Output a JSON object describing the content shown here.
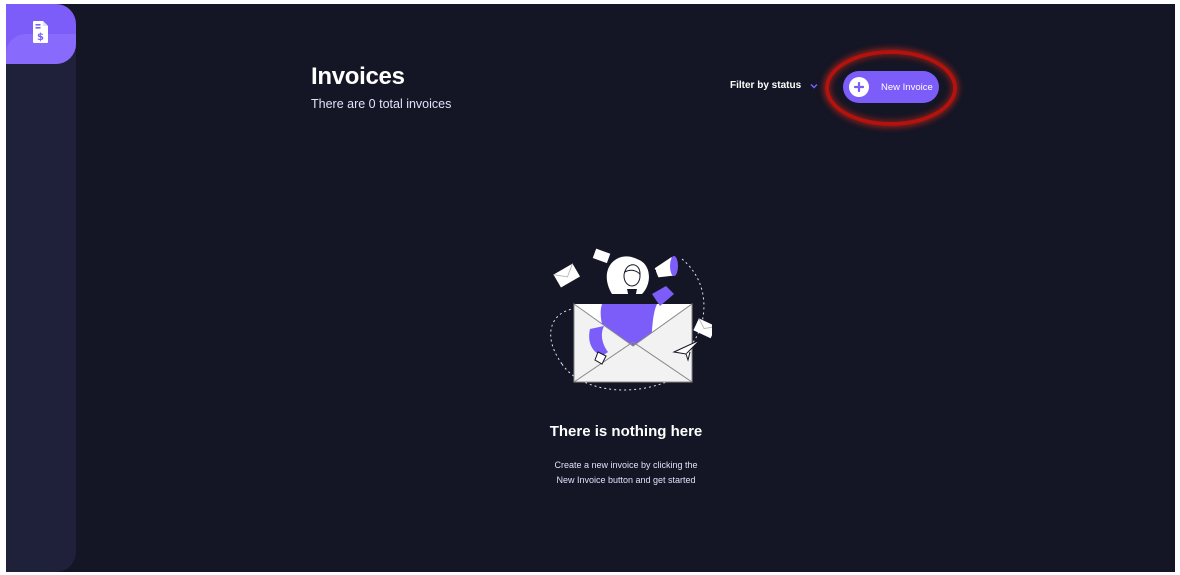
{
  "header": {
    "title": "Invoices",
    "subtitle": "There are 0 total invoices"
  },
  "toolbar": {
    "filter_label": "Filter by status",
    "new_invoice_label": "New Invoice"
  },
  "empty_state": {
    "title": "There is nothing here",
    "line1": "Create a new invoice by clicking the",
    "line2": "New Invoice button and get started"
  },
  "icons": {
    "logo": "invoice-dollar-icon",
    "filter_caret": "chevron-down-icon",
    "new_invoice": "plus-icon"
  },
  "colors": {
    "background": "#141625",
    "sidebar": "#1e2139",
    "accent": "#7c5dfa",
    "highlight_ring": "#b3120d"
  }
}
